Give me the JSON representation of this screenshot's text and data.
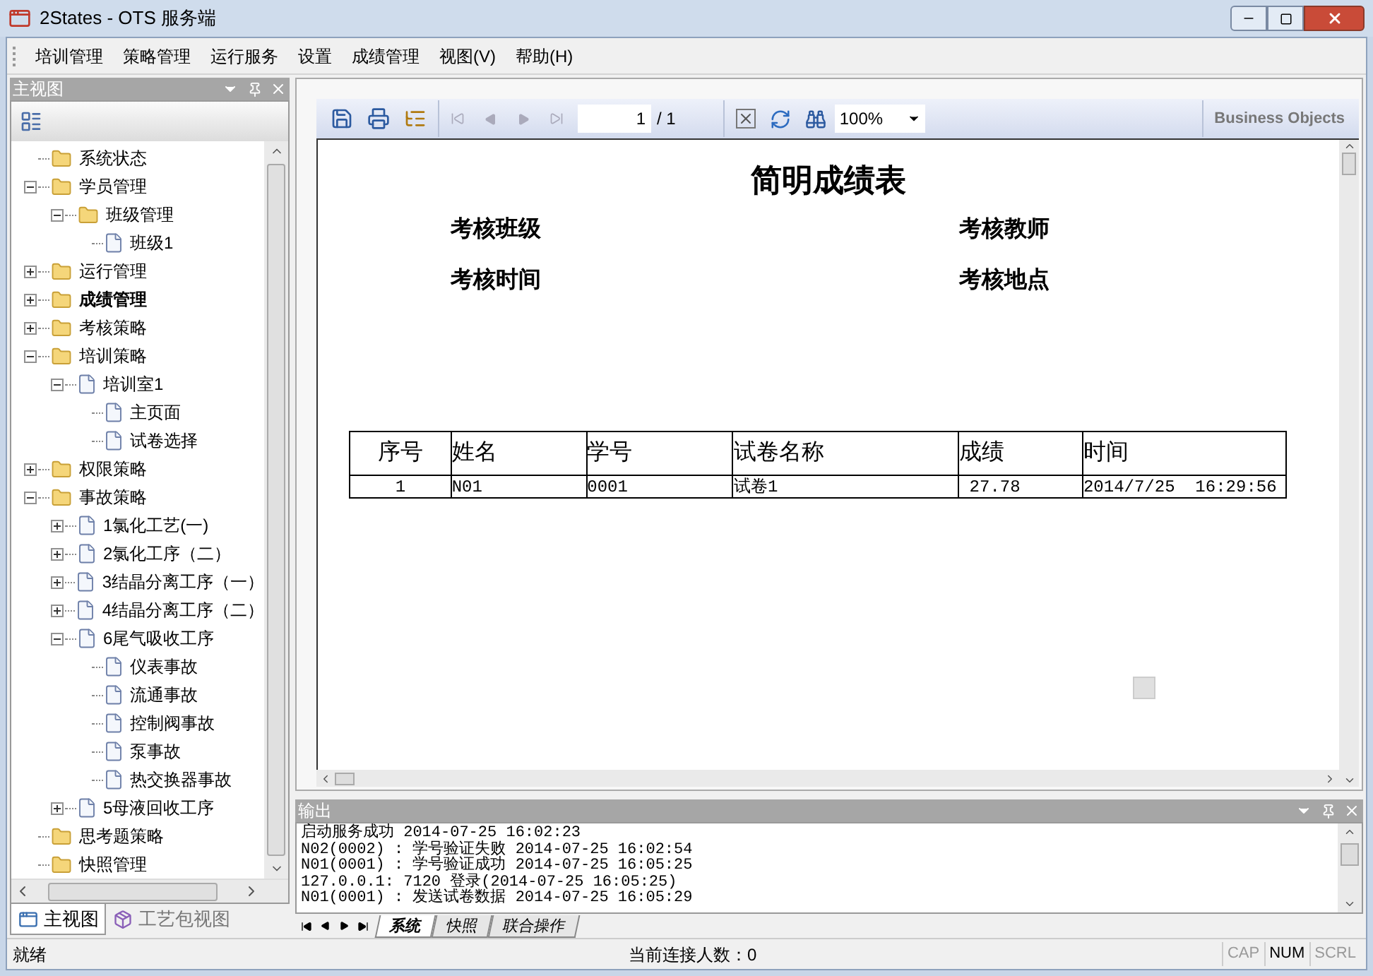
{
  "window": {
    "title": "2States - OTS 服务端"
  },
  "menu": [
    "培训管理",
    "策略管理",
    "运行服务",
    "设置",
    "成绩管理",
    "视图(V)",
    "帮助(H)"
  ],
  "left_panel": {
    "title": "主视图",
    "tree": [
      {
        "label": "系统状态",
        "kind": "folder"
      },
      {
        "label": "学员管理",
        "kind": "folder",
        "expanded": true,
        "children": [
          {
            "label": "班级管理",
            "kind": "folder",
            "expanded": true,
            "children": [
              {
                "label": "班级1",
                "kind": "page"
              }
            ]
          }
        ]
      },
      {
        "label": "运行管理",
        "kind": "folder",
        "expanded": false
      },
      {
        "label": "成绩管理",
        "kind": "folder",
        "expanded": false,
        "bold": true
      },
      {
        "label": "考核策略",
        "kind": "folder",
        "expanded": false
      },
      {
        "label": "培训策略",
        "kind": "folder",
        "expanded": true,
        "children": [
          {
            "label": "培训室1",
            "kind": "page",
            "expanded": true,
            "children": [
              {
                "label": "主页面",
                "kind": "page"
              },
              {
                "label": "试卷选择",
                "kind": "page"
              }
            ]
          }
        ]
      },
      {
        "label": "权限策略",
        "kind": "folder",
        "expanded": false
      },
      {
        "label": "事故策略",
        "kind": "folder",
        "expanded": true,
        "children": [
          {
            "label": "1氯化工艺(一)",
            "kind": "page",
            "expanded": false
          },
          {
            "label": "2氯化工序（二）",
            "kind": "page",
            "expanded": false
          },
          {
            "label": "3结晶分离工序（一）",
            "kind": "page",
            "expanded": false
          },
          {
            "label": "4结晶分离工序（二）",
            "kind": "page",
            "expanded": false
          },
          {
            "label": "6尾气吸收工序",
            "kind": "page",
            "expanded": true,
            "children": [
              {
                "label": "仪表事故",
                "kind": "page"
              },
              {
                "label": "流通事故",
                "kind": "page"
              },
              {
                "label": "控制阀事故",
                "kind": "page"
              },
              {
                "label": "泵事故",
                "kind": "page"
              },
              {
                "label": "热交换器事故",
                "kind": "page"
              }
            ]
          },
          {
            "label": "5母液回收工序",
            "kind": "page",
            "expanded": false
          }
        ]
      },
      {
        "label": "思考题策略",
        "kind": "folder"
      },
      {
        "label": "快照管理",
        "kind": "folder"
      }
    ],
    "tabs": [
      {
        "label": "主视图",
        "selected": true
      },
      {
        "label": "工艺包视图",
        "selected": false
      }
    ]
  },
  "report_toolbar": {
    "page": "1",
    "page_total": "/ 1",
    "zoom": "100%",
    "logo": "Business Objects"
  },
  "report": {
    "title": "简明成绩表",
    "fields": [
      "考核班级",
      "考核教师",
      "考核时间",
      "考核地点"
    ],
    "columns": [
      "序号",
      "姓名",
      "学号",
      "试卷名称",
      "成绩",
      "时间"
    ],
    "rows": [
      [
        "1",
        "N01",
        "0001",
        "试卷1",
        " 27.78",
        "2014/7/25  16:29:56"
      ]
    ]
  },
  "output": {
    "title": "输出",
    "lines": [
      "启动服务成功 2014-07-25 16:02:23",
      "N02(0002) : 学号验证失败 2014-07-25 16:02:54",
      "N01(0001) : 学号验证成功 2014-07-25 16:05:25",
      "127.0.0.1: 7120 登录(2014-07-25 16:05:25)",
      "N01(0001) : 发送试卷数据 2014-07-25 16:05:29"
    ],
    "tabs": [
      {
        "label": "系统",
        "selected": true
      },
      {
        "label": "快照",
        "selected": false
      },
      {
        "label": "联合操作",
        "selected": false
      }
    ]
  },
  "status_bar": {
    "message": "就绪",
    "connections": "当前连接人数：0",
    "indicators": [
      {
        "label": "CAP",
        "on": false
      },
      {
        "label": "NUM",
        "on": true
      },
      {
        "label": "SCRL",
        "on": false
      }
    ]
  }
}
